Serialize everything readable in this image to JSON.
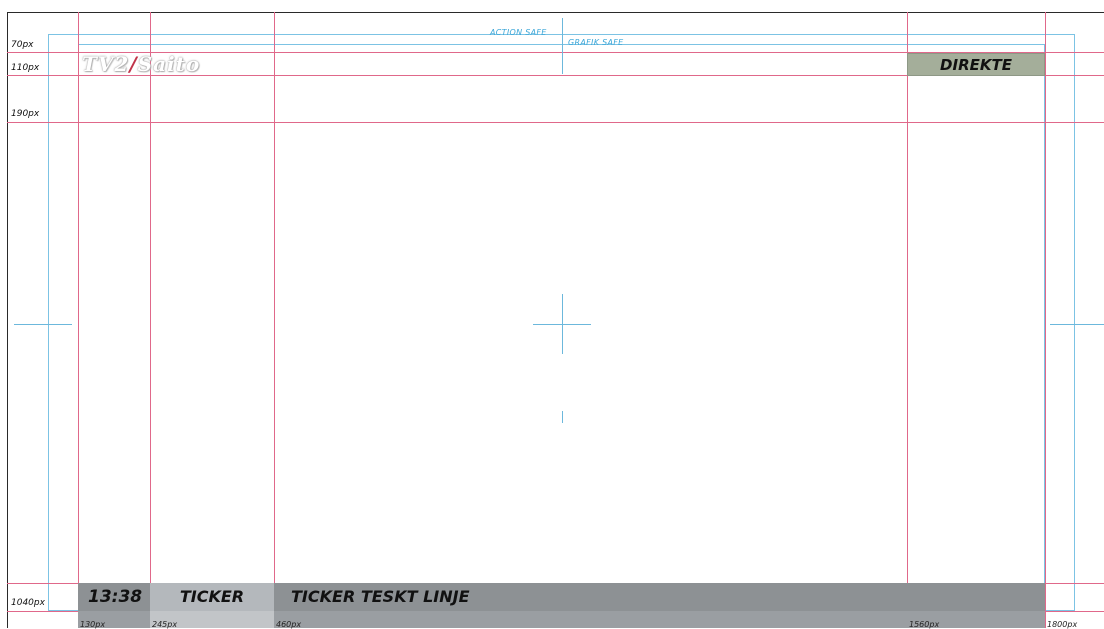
{
  "row_labels": {
    "r70": "70px",
    "r110": "110px",
    "r190": "190px",
    "r1040": "1040px"
  },
  "safe_labels": {
    "action": "ACTION SAFE",
    "grafik": "GRAFIK SAFE"
  },
  "logo": {
    "main": "TV2",
    "slash": "/",
    "sub": "Saito"
  },
  "badge": {
    "label": "DIREKTE",
    "color": "#a4ae9a"
  },
  "ticker": {
    "time": "13:38",
    "label": "TICKER",
    "text": "TICKER TESKT LINJE",
    "bar_color": "#8d9194"
  },
  "col_labels": {
    "c130": "130px",
    "c245": "245px",
    "c460": "460px",
    "c1560": "1560px",
    "c1800": "1800px"
  },
  "colors": {
    "guide_pink": "#e0688a",
    "guide_blue": "#6cb8dc"
  }
}
